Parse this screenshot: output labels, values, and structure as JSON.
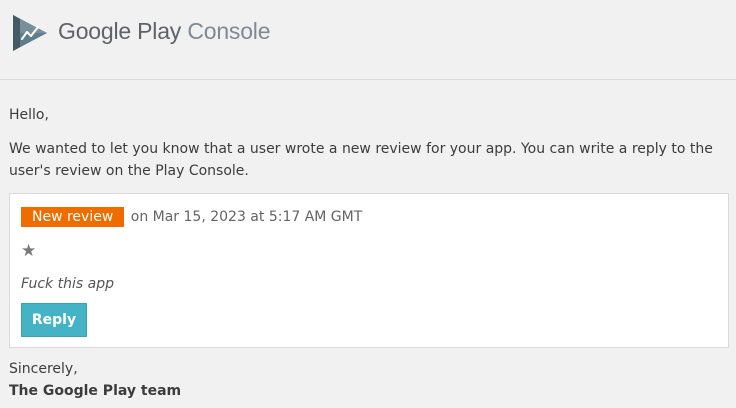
{
  "header": {
    "brand": "Google Play",
    "product": "Console",
    "logo_icon": "play-console-icon"
  },
  "email": {
    "greeting": "Hello,",
    "intro": "We wanted to let you know that a user wrote a new review for your app. You can write a reply to the user's review on the Play Console.",
    "signoff": "Sincerely,",
    "signature": "The Google Play team"
  },
  "review": {
    "badge": "New review",
    "meta": "on Mar 15, 2023 at 5:17 AM GMT",
    "rating_stars": 1,
    "rating_glyph": "★",
    "text": "Fuck this app",
    "reply_label": "Reply"
  },
  "colors": {
    "background": "#f1f1f1",
    "badge": "#ef6c00",
    "reply_button": "#45b3c6",
    "card": "#ffffff"
  }
}
